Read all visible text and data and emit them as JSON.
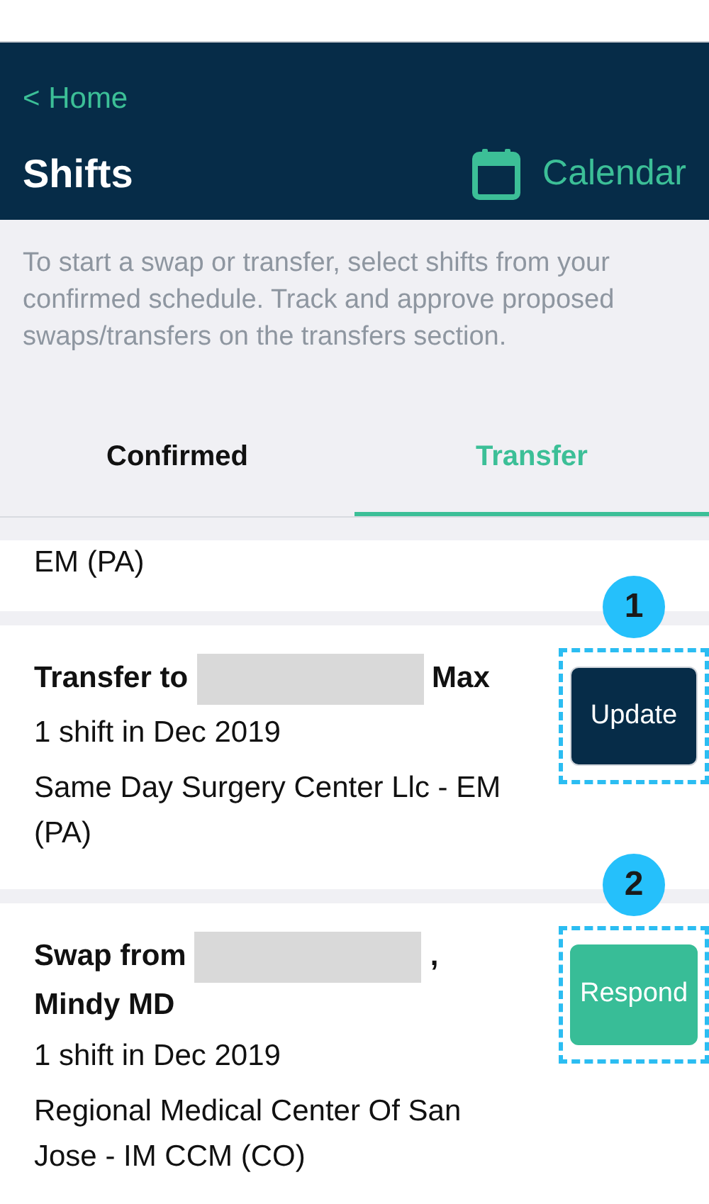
{
  "header": {
    "back_link": "< Home",
    "title": "Shifts",
    "calendar_link": "Calendar"
  },
  "info": "To start a swap or transfer, select shifts from your confirmed schedule. Track and approve proposed swaps/transfers on the transfers section.",
  "tabs": [
    {
      "label": "Confirmed",
      "selected": false
    },
    {
      "label": "Transfer",
      "selected": true
    }
  ],
  "requests": [
    {
      "kind": "partial",
      "location": "EM (PA)"
    },
    {
      "kind": "full",
      "title_prefix": "Transfer to",
      "title_suffix": "Max",
      "summary": "1 shift in Dec 2019",
      "location": "Same Day Surgery Center Llc - EM (PA)",
      "action": {
        "label": "Update",
        "kind": "update"
      },
      "callout": "1"
    },
    {
      "kind": "full",
      "title_prefix": "Swap from",
      "title_suffix": ",",
      "title_line2": "Mindy MD",
      "summary": "1 shift in Dec 2019",
      "location": "Regional Medical Center Of San Jose - IM CCM (CO)",
      "action": {
        "label": "Respond",
        "kind": "respond"
      },
      "callout": "2"
    }
  ]
}
